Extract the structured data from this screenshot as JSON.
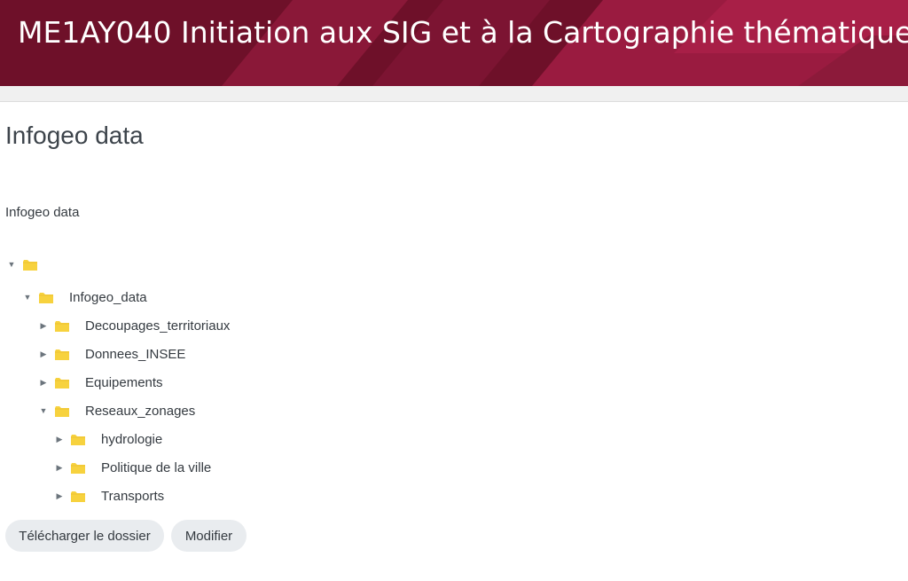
{
  "header": {
    "title": "ME1AY040 Initiation aux SIG et à la Cartographie thématique"
  },
  "page": {
    "title": "Infogeo data",
    "intro": "Infogeo data"
  },
  "tree": {
    "root": {
      "label": "",
      "expanded": true
    },
    "items": [
      {
        "label": "Infogeo_data",
        "expanded": true
      },
      {
        "label": "Decoupages_territoriaux",
        "expanded": false
      },
      {
        "label": "Donnees_INSEE",
        "expanded": false
      },
      {
        "label": "Equipements",
        "expanded": false
      },
      {
        "label": "Reseaux_zonages",
        "expanded": true
      },
      {
        "label": "hydrologie",
        "expanded": false
      },
      {
        "label": "Politique de la ville",
        "expanded": false
      },
      {
        "label": "Transports",
        "expanded": false
      }
    ]
  },
  "actions": {
    "download_label": "Télécharger le dossier",
    "edit_label": "Modifier"
  },
  "colors": {
    "header_bg": "#7a1530",
    "folder": "#f7d23e",
    "button_bg": "#e9ecef"
  },
  "icons": {
    "expanded": "triangle-down-icon",
    "collapsed": "triangle-right-icon",
    "folder": "folder-icon"
  }
}
